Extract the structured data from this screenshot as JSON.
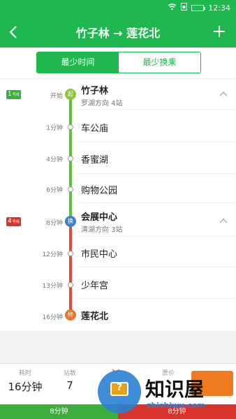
{
  "status_bar": {
    "time": "12:34",
    "icons": [
      "wifi-icon",
      "sim-icon",
      "battery-icon"
    ]
  },
  "header": {
    "title": "竹子林 → 莲花北",
    "back_icon": "chevron-left",
    "add_icon": "plus"
  },
  "tabs": [
    {
      "label": "最少时间",
      "active": true
    },
    {
      "label": "最少换乘",
      "active": false
    }
  ],
  "route": {
    "line1_badge": {
      "number": "1",
      "suffix": "号线",
      "color": "#3cae3c"
    },
    "line4_badge": {
      "number": "4",
      "suffix": "号线",
      "color": "#d8342b"
    },
    "stations": [
      {
        "time": "开始",
        "name": "竹子林",
        "marker": "起",
        "sub": "罗湖方向 4站"
      },
      {
        "time": "1分钟",
        "name": "车公庙"
      },
      {
        "time": "4分钟",
        "name": "香蜜湖"
      },
      {
        "time": "6分钟",
        "name": "购物公园"
      },
      {
        "time": "8分钟",
        "name": "会展中心",
        "marker": "换",
        "sub": "清湖方向 3站"
      },
      {
        "time": "12分钟",
        "name": "市民中心"
      },
      {
        "time": "13分钟",
        "name": "少年宫"
      },
      {
        "time": "16分钟",
        "name": "莲花北",
        "marker": "终"
      }
    ]
  },
  "summary": {
    "duration_label": "耗时",
    "duration_value": "16分钟",
    "stops_label": "站数",
    "stops_value": "7",
    "price_label": "票价",
    "bar_green_label": "8分钟",
    "bar_red_label": "8分钟"
  },
  "watermark": {
    "text": "知识屋",
    "url": "zhishiwu.com"
  }
}
